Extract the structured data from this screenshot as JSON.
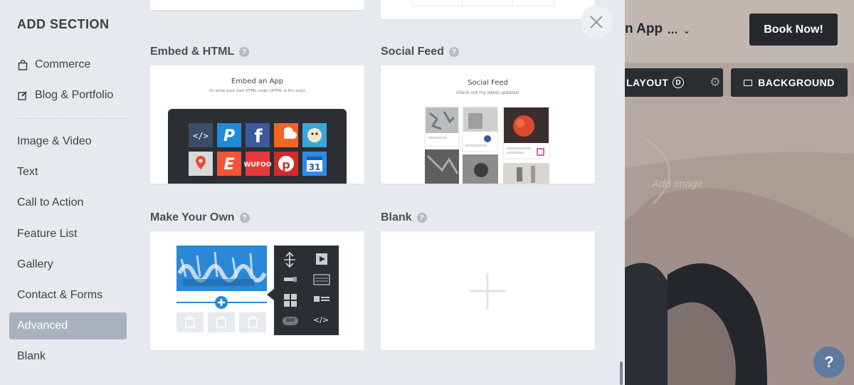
{
  "sidebar": {
    "title": "ADD SECTION",
    "items": [
      {
        "label": "Commerce",
        "icon": "bag-icon"
      },
      {
        "label": "Blog & Portfolio",
        "icon": "edit-icon"
      },
      {
        "label": "Image & Video"
      },
      {
        "label": "Text"
      },
      {
        "label": "Call to Action"
      },
      {
        "label": "Feature List"
      },
      {
        "label": "Gallery"
      },
      {
        "label": "Contact & Forms"
      },
      {
        "label": "Advanced",
        "active": true
      },
      {
        "label": "Blank"
      }
    ]
  },
  "sections": {
    "embed": {
      "title": "Embed & HTML",
      "preview_title": "Embed an App",
      "preview_subtitle": "Or write your own HTML code! (HTML is Pro only)"
    },
    "social": {
      "title": "Social Feed",
      "preview_title": "Social Feed",
      "preview_subtitle": "Check out my latest updates!"
    },
    "make_your_own": {
      "title": "Make Your Own",
      "go_label": "GO",
      "code_label": "</>"
    },
    "blank": {
      "title": "Blank"
    }
  },
  "site_preview": {
    "title_fragment": "n App",
    "more_label": "...",
    "book_button": "Book Now!",
    "layout_button": "LAYOUT",
    "layout_badge": "D",
    "background_button": "BACKGROUND",
    "add_image_placeholder": "Add image",
    "help_label": "?"
  },
  "colors": {
    "panel_bg": "#e6eaef",
    "active_item_bg": "#a9b2bc",
    "dark_button": "#25282c",
    "help_fab": "#5d7b9e"
  }
}
